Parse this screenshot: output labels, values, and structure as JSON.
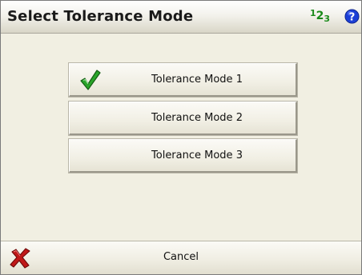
{
  "dialog": {
    "title": "Select Tolerance Mode",
    "icons": {
      "input_panel": "123-input-icon",
      "help": "help-icon"
    },
    "input_panel_text": {
      "one": "1",
      "two": "2",
      "three": "3"
    }
  },
  "modes": [
    {
      "label": "Tolerance Mode 1",
      "selected": true
    },
    {
      "label": "Tolerance Mode 2",
      "selected": false
    },
    {
      "label": "Tolerance Mode 3",
      "selected": false
    }
  ],
  "footer": {
    "cancel_label": "Cancel",
    "cancel_icon": "red-x-icon"
  },
  "colors": {
    "help_blue": "#1c3fd6",
    "check_green": "#2aa52a",
    "cancel_red": "#c01818"
  }
}
